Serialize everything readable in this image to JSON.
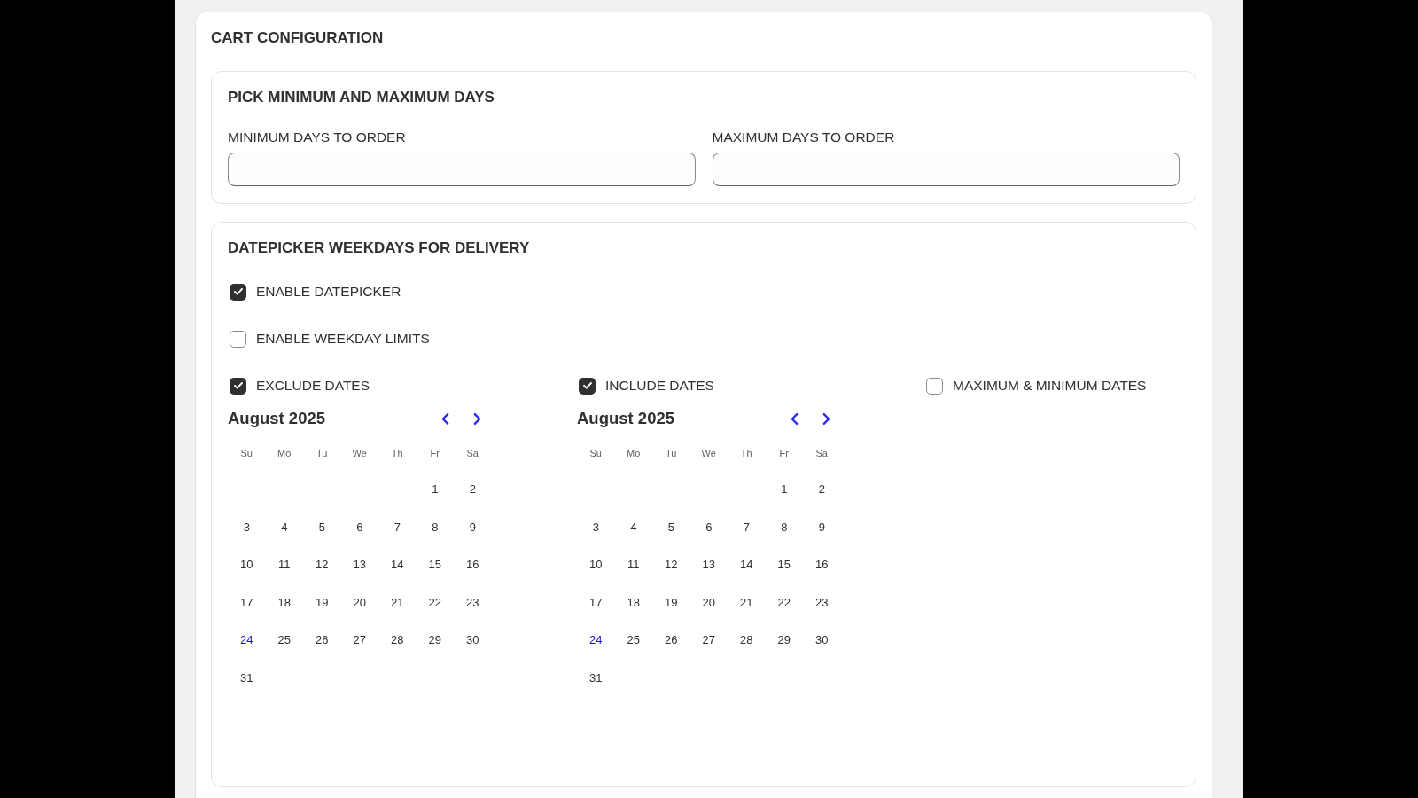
{
  "card": {
    "title": "CART CONFIGURATION"
  },
  "days_section": {
    "title": "PICK MINIMUM AND MAXIMUM DAYS",
    "fields": [
      {
        "label": "MINIMUM DAYS TO ORDER"
      },
      {
        "label": "MAXIMUM DAYS TO ORDER"
      }
    ]
  },
  "datepicker_section": {
    "title": "DATEPICKER WEEKDAYS FOR DELIVERY",
    "options": [
      {
        "label": "ENABLE DATEPICKER",
        "checked": true
      },
      {
        "label": "ENABLE WEEKDAY LIMITS",
        "checked": false
      }
    ],
    "date_options": [
      {
        "label": "EXCLUDE DATES",
        "checked": true,
        "calendar": {
          "month": "August 2025",
          "weekdays": [
            "Su",
            "Mo",
            "Tu",
            "We",
            "Th",
            "Fr",
            "Sa"
          ],
          "weeks": [
            [
              {
                "day": "1",
                "today": false
              },
              {
                "day": "2",
                "today": false
              }
            ],
            [
              {
                "day": "3",
                "today": false
              },
              {
                "day": "4",
                "today": false
              },
              {
                "day": "5",
                "today": false
              },
              {
                "day": "6",
                "today": false
              },
              {
                "day": "7",
                "today": false
              },
              {
                "day": "8",
                "today": false
              },
              {
                "day": "9",
                "today": false
              }
            ],
            [
              {
                "day": "10",
                "today": false
              },
              {
                "day": "11",
                "today": false
              },
              {
                "day": "12",
                "today": false
              },
              {
                "day": "13",
                "today": false
              },
              {
                "day": "14",
                "today": false
              },
              {
                "day": "15",
                "today": false
              },
              {
                "day": "16",
                "today": false
              }
            ],
            [
              {
                "day": "17",
                "today": false
              },
              {
                "day": "18",
                "today": false
              },
              {
                "day": "19",
                "today": false
              },
              {
                "day": "20",
                "today": false
              },
              {
                "day": "21",
                "today": false
              },
              {
                "day": "22",
                "today": false
              },
              {
                "day": "23",
                "today": false
              }
            ],
            [
              {
                "day": "24",
                "today": true
              },
              {
                "day": "25",
                "today": false
              },
              {
                "day": "26",
                "today": false
              },
              {
                "day": "27",
                "today": false
              },
              {
                "day": "28",
                "today": false
              },
              {
                "day": "29",
                "today": false
              },
              {
                "day": "30",
                "today": false
              }
            ],
            [
              {
                "day": "31",
                "today": false
              }
            ]
          ]
        }
      },
      {
        "label": "INCLUDE DATES",
        "checked": true,
        "calendar": {
          "month": "August 2025",
          "weekdays": [
            "Su",
            "Mo",
            "Tu",
            "We",
            "Th",
            "Fr",
            "Sa"
          ],
          "weeks": [
            [
              {
                "day": "1",
                "today": false
              },
              {
                "day": "2",
                "today": false
              }
            ],
            [
              {
                "day": "3",
                "today": false
              },
              {
                "day": "4",
                "today": false
              },
              {
                "day": "5",
                "today": false
              },
              {
                "day": "6",
                "today": false
              },
              {
                "day": "7",
                "today": false
              },
              {
                "day": "8",
                "today": false
              },
              {
                "day": "9",
                "today": false
              }
            ],
            [
              {
                "day": "10",
                "today": false
              },
              {
                "day": "11",
                "today": false
              },
              {
                "day": "12",
                "today": false
              },
              {
                "day": "13",
                "today": false
              },
              {
                "day": "14",
                "today": false
              },
              {
                "day": "15",
                "today": false
              },
              {
                "day": "16",
                "today": false
              }
            ],
            [
              {
                "day": "17",
                "today": false
              },
              {
                "day": "18",
                "today": false
              },
              {
                "day": "19",
                "today": false
              },
              {
                "day": "20",
                "today": false
              },
              {
                "day": "21",
                "today": false
              },
              {
                "day": "22",
                "today": false
              },
              {
                "day": "23",
                "today": false
              }
            ],
            [
              {
                "day": "24",
                "today": true
              },
              {
                "day": "25",
                "today": false
              },
              {
                "day": "26",
                "today": false
              },
              {
                "day": "27",
                "today": false
              },
              {
                "day": "28",
                "today": false
              },
              {
                "day": "29",
                "today": false
              },
              {
                "day": "30",
                "today": false
              }
            ],
            [
              {
                "day": "31",
                "today": false
              }
            ]
          ]
        }
      },
      {
        "label": "MAXIMUM & MINIMUM DATES",
        "checked": false
      }
    ]
  }
}
